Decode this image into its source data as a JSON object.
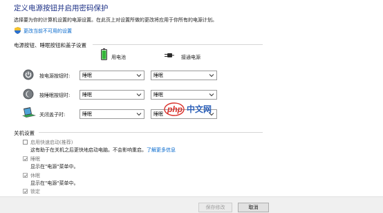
{
  "page": {
    "title": "定义电源按钮并启用密码保护",
    "subtitle": "选择要为你的计算机设置的电源设置。在此页上对设置所做的更改将应用于你所有的电源计划。",
    "admin_link": "更改当前不可用的设置"
  },
  "buttons_section": {
    "title": "电源按钮、睡眠按钮和盖子设置",
    "col_battery": "用电池",
    "col_plugged": "接通电源",
    "rows": [
      {
        "label": "按电源按钮时:",
        "battery": "睡眠",
        "plugged": "睡眠",
        "icon": "power-icon"
      },
      {
        "label": "按睡眠按钮时:",
        "battery": "睡眠",
        "plugged": "睡眠",
        "icon": "sleep-icon"
      },
      {
        "label": "关闭盖子时:",
        "battery": "睡眠",
        "plugged": "睡眠",
        "icon": "laptop-lid-icon"
      }
    ]
  },
  "shutdown_section": {
    "title": "关机设置",
    "items": [
      {
        "label": "启用快速启动(推荐)",
        "checked": false,
        "desc": "这有助于在关机之后更快地启动电脑。不会影响重启。",
        "link": "了解更多信息"
      },
      {
        "label": "睡眠",
        "checked": true,
        "desc": "显示在\"电源\"菜单中。"
      },
      {
        "label": "休眠",
        "checked": true,
        "desc": "显示在\"电源\"菜单中。"
      },
      {
        "label": "锁定",
        "checked": true,
        "desc": ""
      }
    ]
  },
  "footer": {
    "save_label": "保存修改",
    "cancel_label": "取消"
  },
  "watermark": {
    "text_a": "php",
    "text_b": "中文网"
  },
  "colors": {
    "title": "#1e3287",
    "link": "#0066cc",
    "watermark_red": "#d9312b",
    "watermark_blue": "#2b5fb8"
  }
}
